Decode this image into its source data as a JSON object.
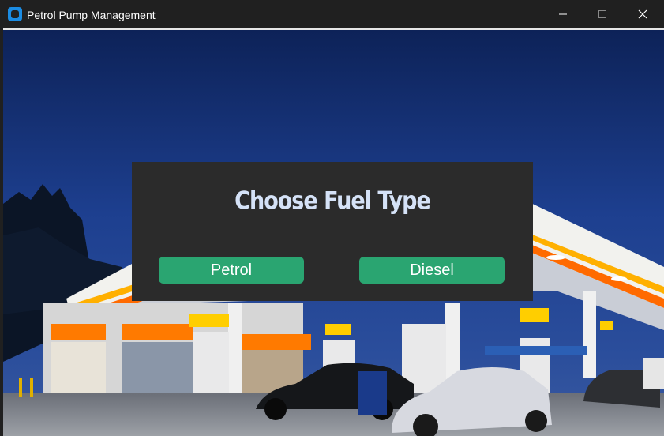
{
  "window": {
    "title": "Petrol Pump Management"
  },
  "dialog": {
    "heading": "Choose Fuel Type",
    "buttons": {
      "petrol": "Petrol",
      "diesel": "Diesel"
    }
  },
  "colors": {
    "titlebar": "#202020",
    "dialog_background": "#2b2b2b",
    "button_green": "#2aa571",
    "heading_text": "#d5e2f7"
  },
  "icons": {
    "app": "app-icon",
    "minimize": "minimize-icon",
    "maximize": "maximize-icon",
    "close": "close-icon"
  }
}
